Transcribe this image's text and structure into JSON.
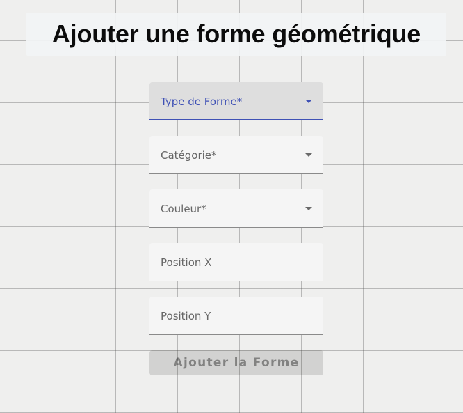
{
  "page": {
    "title": "Ajouter une forme géométrique"
  },
  "form": {
    "fields": [
      {
        "label": "Type de Forme*",
        "kind": "select",
        "focused": true,
        "icon": "dropdown-arrow-icon"
      },
      {
        "label": "Catégorie*",
        "kind": "select",
        "focused": false,
        "icon": "dropdown-arrow-icon"
      },
      {
        "label": "Couleur*",
        "kind": "select",
        "focused": false,
        "icon": "dropdown-arrow-icon"
      },
      {
        "label": "Position X",
        "kind": "input",
        "value": ""
      },
      {
        "label": "Position Y",
        "kind": "input",
        "value": ""
      }
    ],
    "submit_label": "Ajouter la Forme",
    "submit_disabled": true
  },
  "colors": {
    "accent": "#3f51b5",
    "field_background": "#f5f5f5",
    "focused_field_background": "#dedede",
    "background": "#efefee"
  }
}
